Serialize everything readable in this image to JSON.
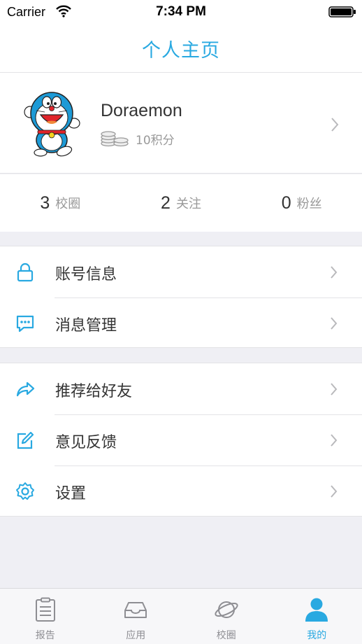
{
  "status_bar": {
    "carrier": "Carrier",
    "time": "7:34 PM"
  },
  "nav": {
    "title": "个人主页"
  },
  "profile": {
    "username": "Doraemon",
    "points": "10积分"
  },
  "stats": [
    {
      "count": "3",
      "label": "校圈"
    },
    {
      "count": "2",
      "label": "关注"
    },
    {
      "count": "0",
      "label": "粉丝"
    }
  ],
  "menu_group1": [
    {
      "label": "账号信息",
      "icon": "lock-icon"
    },
    {
      "label": "消息管理",
      "icon": "message-icon"
    }
  ],
  "menu_group2": [
    {
      "label": "推荐给好友",
      "icon": "share-icon"
    },
    {
      "label": "意见反馈",
      "icon": "edit-icon"
    },
    {
      "label": "设置",
      "icon": "gear-icon"
    }
  ],
  "tabs": [
    {
      "label": "报告",
      "icon": "report-icon",
      "active": false
    },
    {
      "label": "应用",
      "icon": "inbox-icon",
      "active": false
    },
    {
      "label": "校圈",
      "icon": "planet-icon",
      "active": false
    },
    {
      "label": "我的",
      "icon": "user-icon",
      "active": true
    }
  ],
  "colors": {
    "accent": "#29a9e1",
    "background": "#efeff4",
    "text": "#333333",
    "secondary_text": "#999999"
  }
}
